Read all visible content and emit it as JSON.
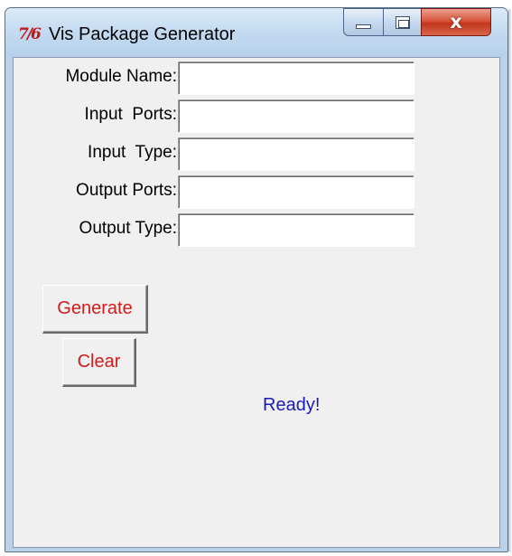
{
  "window": {
    "title": "Vis Package Generator",
    "icon": "tk-feather-icon",
    "controls": {
      "minimize_icon": "minimize-icon",
      "maximize_icon": "maximize-icon",
      "close_icon": "close-icon",
      "close_glyph": "x"
    }
  },
  "form": {
    "fields": [
      {
        "label": "Module Name:",
        "value": ""
      },
      {
        "label": "Input  Ports:",
        "value": ""
      },
      {
        "label": "Input  Type:",
        "value": ""
      },
      {
        "label": "Output Ports:",
        "value": ""
      },
      {
        "label": "Output Type:",
        "value": ""
      }
    ]
  },
  "buttons": {
    "generate_label": "Generate",
    "clear_label": "Clear"
  },
  "status": {
    "text": "Ready!"
  },
  "colors": {
    "button_text": "#d11b1b",
    "status_text": "#1a1ab4",
    "client_background": "#f0f0f0"
  }
}
